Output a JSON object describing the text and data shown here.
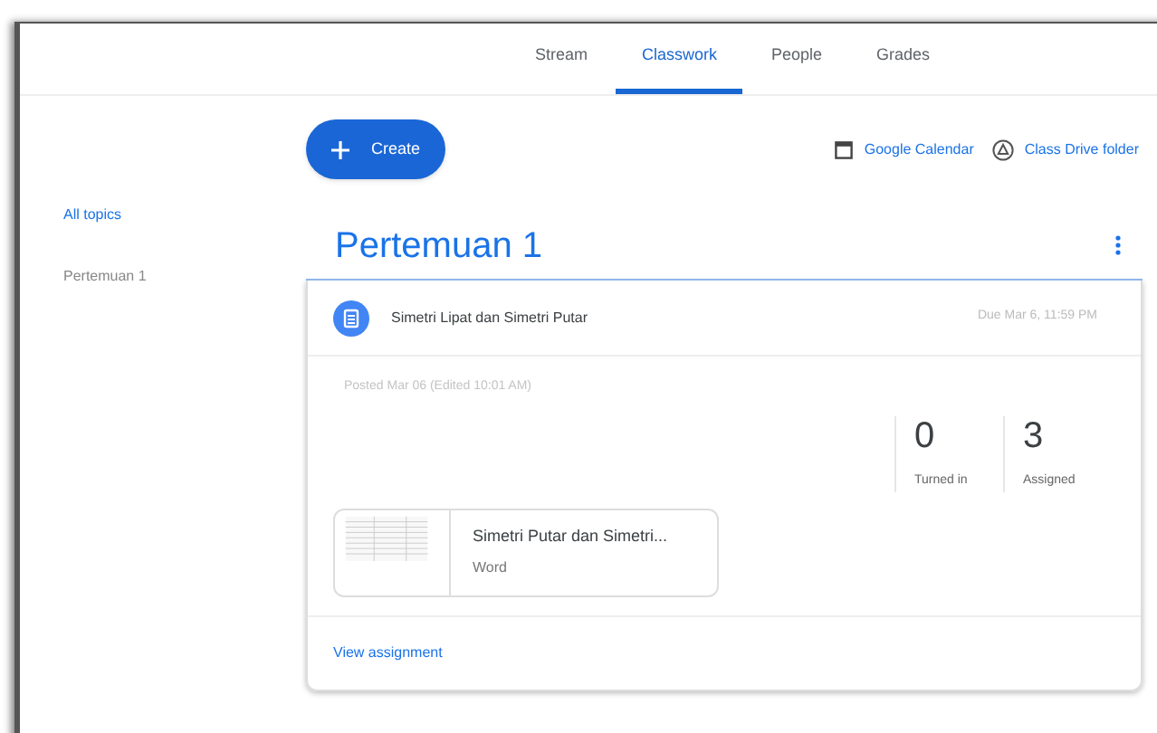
{
  "tabs": [
    {
      "label": "Stream",
      "selected": false
    },
    {
      "label": "Classwork",
      "selected": true
    },
    {
      "label": "People",
      "selected": false
    },
    {
      "label": "Grades",
      "selected": false
    }
  ],
  "create_button": "Create",
  "links": [
    "Google Calendar",
    "Class Drive folder"
  ],
  "sidebar": {
    "items": [
      {
        "label": "All topics",
        "selected": true
      },
      {
        "label": "Pertemuan 1",
        "selected": false
      }
    ]
  },
  "topic": {
    "title": "Pertemuan 1"
  },
  "assignment": {
    "title": "Simetri Lipat dan Simetri Putar",
    "due": "Due Mar 6, 11:59 PM",
    "posted": "Posted Mar 06 (Edited 10:01 AM)",
    "stats": [
      {
        "value": "0",
        "label": "Turned in"
      },
      {
        "value": "3",
        "label": "Assigned"
      }
    ],
    "attachment": {
      "name": "Simetri Putar dan Simetri...",
      "type": "Word"
    },
    "action": "View assignment"
  }
}
